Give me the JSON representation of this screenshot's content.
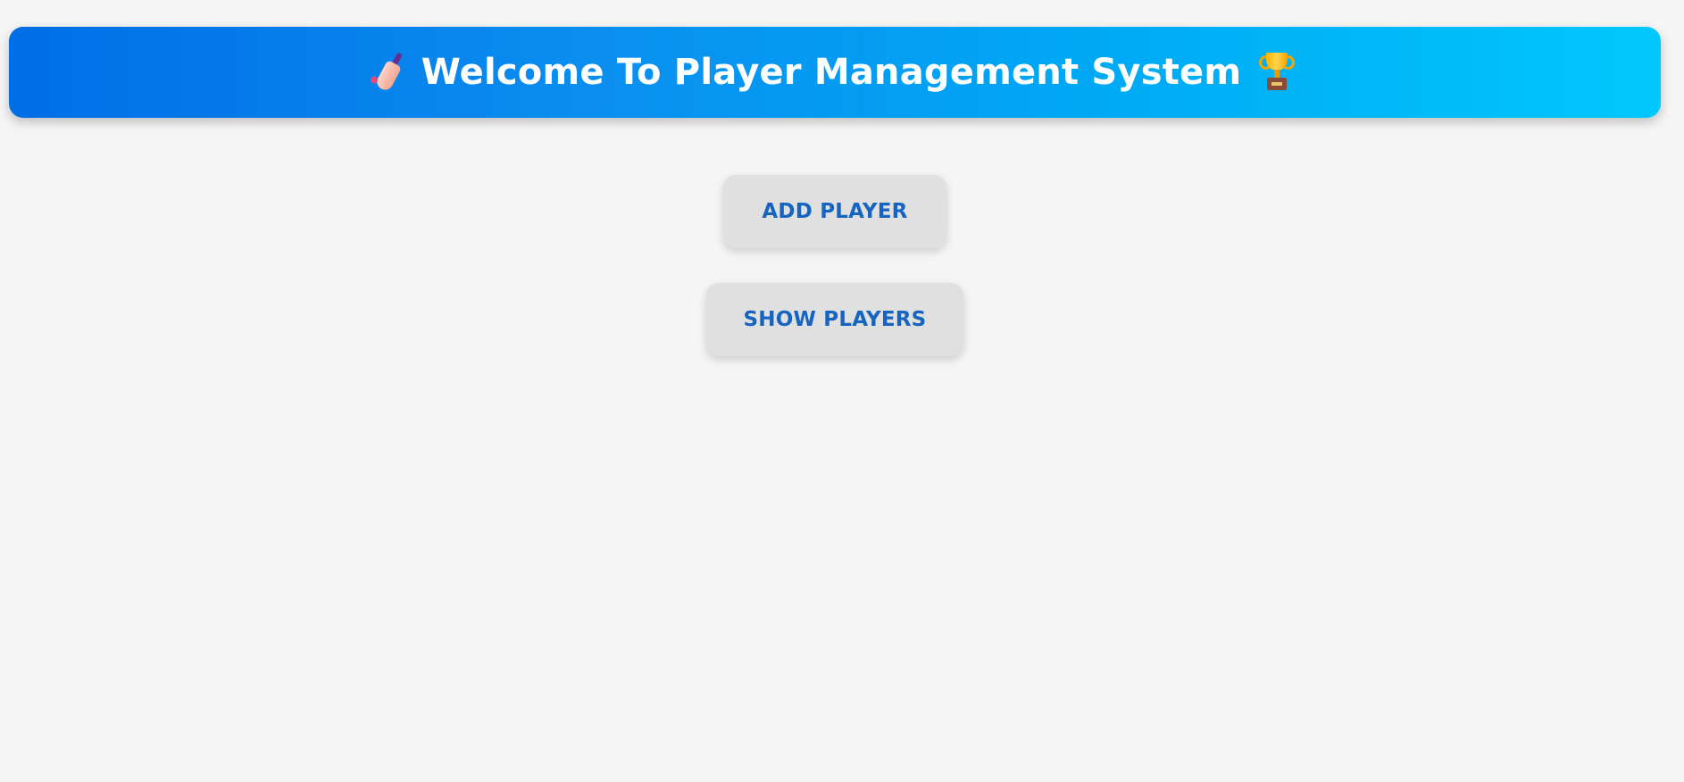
{
  "header": {
    "title": "Welcome To Player Management System",
    "left_icon": "cricket-bat-icon",
    "right_icon": "trophy-icon",
    "gradient_start": "#006ee6",
    "gradient_end": "#00c8fc"
  },
  "actions": {
    "add_player_label": "ADD PLAYER",
    "show_players_label": "SHOW PLAYERS",
    "button_text_color": "#1565c0",
    "button_bg_color": "#e0e0e0"
  },
  "page": {
    "background_color": "#f5f5f5"
  }
}
